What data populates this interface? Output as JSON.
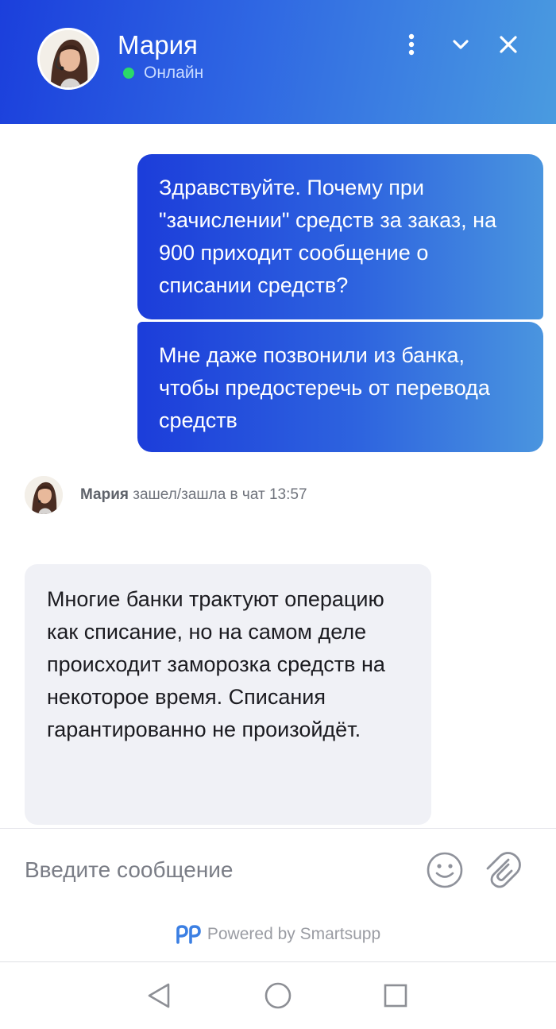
{
  "header": {
    "agent_name": "Мария",
    "status": "Онлайн",
    "status_color": "#2bd96a",
    "gradient_colors": [
      "#1b3fdc",
      "#4a9be0"
    ],
    "icons": {
      "more": "more-vertical-icon",
      "minimize": "chevron-down-icon",
      "close": "close-icon"
    }
  },
  "messages": {
    "outgoing": [
      {
        "text": "Здравствуйте. Почему при \"зачислении\" средств за заказ, на 900 приходит сообщение о списании средств?"
      },
      {
        "text": "Мне даже позвонили из банка, чтобы предостеречь от перевода средств"
      }
    ],
    "join_event": {
      "name": "Мария",
      "text": "зашел/зашла в чат 13:57"
    },
    "incoming": [
      {
        "text": "Многие банки трактуют операцию как списание, но на самом деле происходит заморозка средств на некоторое время. Списания гарантированно не произойдёт."
      }
    ]
  },
  "composer": {
    "placeholder": "Введите сообщение",
    "icons": {
      "emoji": "emoji-icon",
      "attach": "paperclip-icon"
    }
  },
  "footer": {
    "powered_by": "Powered by Smartsupp",
    "logo": "smartsupp-logo-icon"
  },
  "navbar": {
    "icons": [
      "back-triangle-icon",
      "home-circle-icon",
      "recent-apps-square-icon"
    ]
  }
}
